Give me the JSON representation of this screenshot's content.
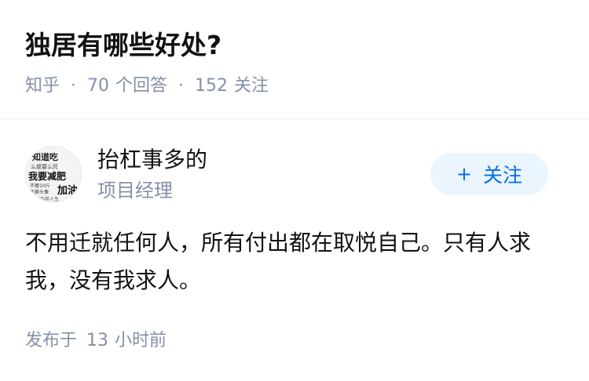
{
  "question": {
    "title": "独居有哪些好处?",
    "source": "知乎",
    "separator": "·",
    "answer_count": "70",
    "answer_label": "个回答",
    "follower_count": "152",
    "follower_label": "关注"
  },
  "author": {
    "name": "抬杠事多的",
    "headline": "项目经理",
    "avatar_icon": "text-collage-avatar",
    "avatar_text": [
      "知道吃",
      "么瘦要么死",
      "我要减肥",
      "不瘦10斤",
      "不换头像",
      "加油",
      "吃会胖人生"
    ]
  },
  "follow_button": {
    "icon": "plus-icon",
    "label": "关注",
    "color": "#056de8",
    "background": "#ebf5fd"
  },
  "answer": {
    "content": "不用迁就任何人，所有付出都在取悦自己。只有人求我，没有我求人。"
  },
  "meta": {
    "published_prefix": "发布于",
    "published_value": "13",
    "published_suffix": "小时前"
  }
}
